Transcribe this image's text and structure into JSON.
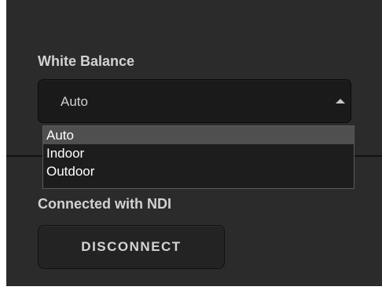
{
  "white_balance": {
    "label": "White Balance",
    "selected_value": "Auto",
    "options": [
      "Auto",
      "Indoor",
      "Outdoor"
    ]
  },
  "connection": {
    "status_text": "Connected with NDI",
    "disconnect_label": "DISCONNECT"
  },
  "icons": {
    "dropdown_caret": "caret-up-icon"
  },
  "colors": {
    "panel_bg": "#2b2b2b",
    "option_highlight": "#4f4f4f",
    "text": "#d2d2d2"
  }
}
